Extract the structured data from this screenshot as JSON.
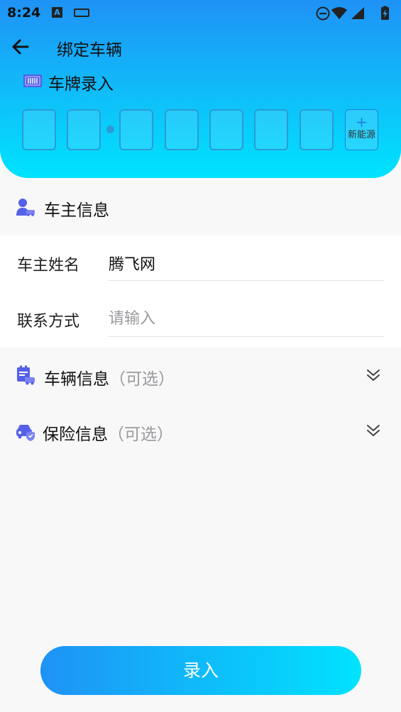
{
  "status_bar": {
    "time": "8:24",
    "notification_icon_letter": "A",
    "icons": [
      "a-notification-icon",
      "keyboard-icon",
      "do-not-disturb-icon",
      "wifi-icon",
      "signal-icon",
      "battery-charging-icon"
    ]
  },
  "header": {
    "title": "绑定车辆",
    "back_icon": "arrow-left-icon",
    "gradient": [
      "#1f92f6",
      "#00e3fe"
    ]
  },
  "plate": {
    "label": "车牌录入",
    "icon": "license-plate-icon",
    "chars": [
      "",
      "",
      "",
      "",
      "",
      "",
      ""
    ],
    "new_energy_plus": "+",
    "new_energy_label": "新能源"
  },
  "owner": {
    "heading": "车主信息",
    "icon": "owner-car-icon",
    "fields": [
      {
        "label": "车主姓名",
        "value": "腾飞网",
        "placeholder": ""
      },
      {
        "label": "联系方式",
        "value": "",
        "placeholder": "请输入"
      }
    ]
  },
  "vehicle": {
    "heading": "车辆信息",
    "optional": "（可选）",
    "icon": "vehicle-info-icon"
  },
  "insurance": {
    "heading": "保险信息",
    "optional": "（可选）",
    "icon": "insurance-car-icon"
  },
  "submit": {
    "label": "录入"
  },
  "colors": {
    "accent": "#1f92f6",
    "icon_purple": "#5560e8",
    "plate_border": "#2a9bd6"
  }
}
